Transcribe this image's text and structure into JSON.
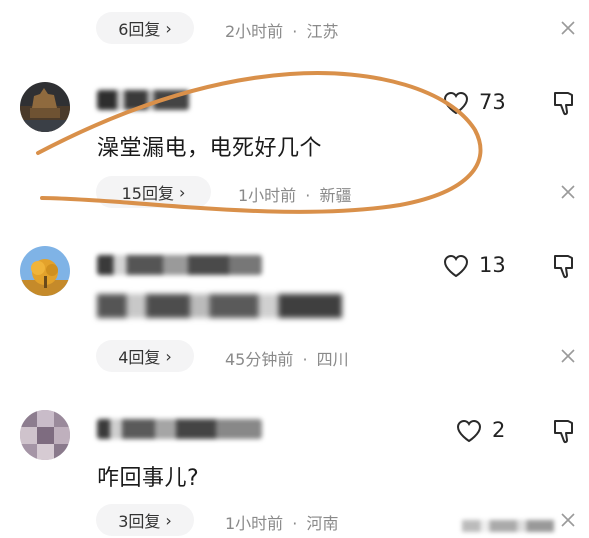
{
  "comments": [
    {
      "text": "",
      "likes": "",
      "replies": "6回复",
      "time": "2小时前",
      "location": "江苏"
    },
    {
      "text": "澡堂漏电，电死好几个",
      "likes": "73",
      "replies": "15回复",
      "time": "1小时前",
      "location": "新疆"
    },
    {
      "text": "",
      "likes": "13",
      "replies": "4回复",
      "time": "45分钟前",
      "location": "四川"
    },
    {
      "text": "咋回事儿?",
      "likes": "2",
      "replies": "3回复",
      "time": "1小时前",
      "location": "河南"
    }
  ],
  "meta_separator": "·",
  "reply_chevron": "›",
  "icons": {
    "like": "heart-outline-icon",
    "dislike": "thumbs-down-outline-icon",
    "close": "close-icon"
  },
  "colors": {
    "annotation_stroke": "#d9904a",
    "meta_text": "#8a8a8a",
    "pill_bg": "#f4f4f5"
  }
}
